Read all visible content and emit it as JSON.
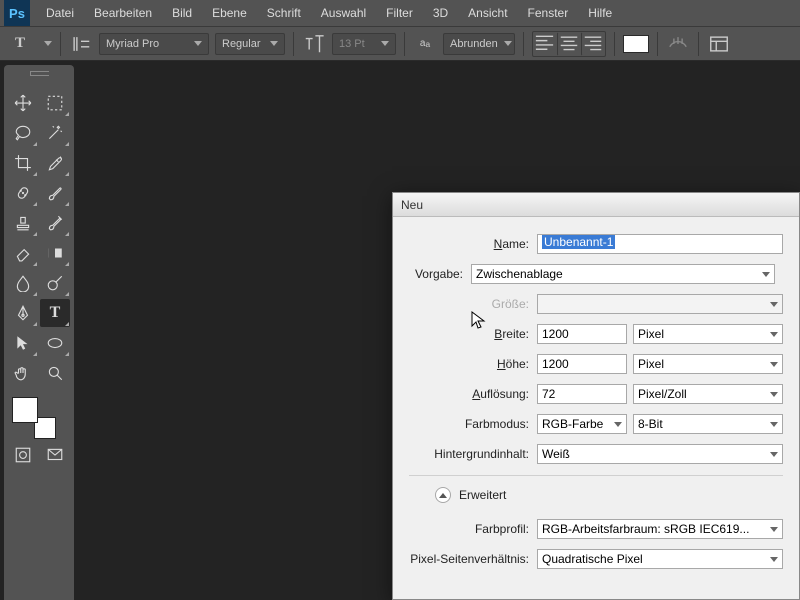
{
  "app": {
    "logo": "Ps"
  },
  "menubar": [
    "Datei",
    "Bearbeiten",
    "Bild",
    "Ebene",
    "Schrift",
    "Auswahl",
    "Filter",
    "3D",
    "Ansicht",
    "Fenster",
    "Hilfe"
  ],
  "options": {
    "tool_glyph": "T",
    "font_family": "Myriad Pro",
    "font_style": "Regular",
    "font_size": "13 Pt",
    "antialias": "Abrunden",
    "align_left": "L",
    "align_center": "C",
    "align_right": "R",
    "color": "#ffffff"
  },
  "dialog": {
    "title": "Neu",
    "name_label": "Name:",
    "name_value": "Unbenannt-1",
    "preset_label": "Vorgabe:",
    "preset_value": "Zwischenablage",
    "size_label": "Größe:",
    "size_value": "",
    "width_label": "Breite:",
    "width_value": "1200",
    "width_unit": "Pixel",
    "height_label": "Höhe:",
    "height_value": "1200",
    "height_unit": "Pixel",
    "res_label": "Auflösung:",
    "res_value": "72",
    "res_unit": "Pixel/Zoll",
    "mode_label": "Farbmodus:",
    "mode_value": "RGB-Farbe",
    "depth_value": "8-Bit",
    "bg_label": "Hintergrundinhalt:",
    "bg_value": "Weiß",
    "advanced": "Erweitert",
    "profile_label": "Farbprofil:",
    "profile_value": "RGB-Arbeitsfarbraum:  sRGB IEC619...",
    "par_label": "Pixel-Seitenverhältnis:",
    "par_value": "Quadratische Pixel"
  }
}
